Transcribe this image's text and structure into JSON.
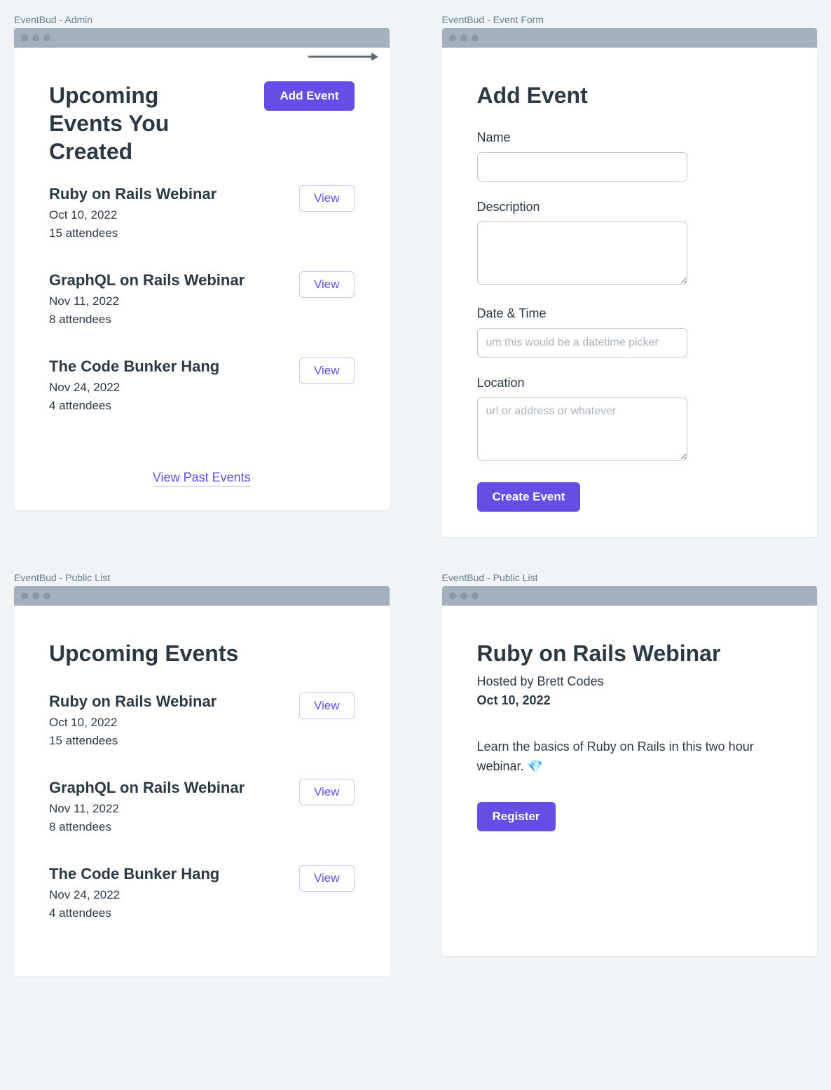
{
  "admin": {
    "window_label": "EventBud - Admin",
    "title": "Upcoming Events You Created",
    "add_button": "Add Event",
    "events": [
      {
        "title": "Ruby on Rails Webinar",
        "date": "Oct 10, 2022",
        "attendees": "15 attendees",
        "view": "View"
      },
      {
        "title": "GraphQL on Rails Webinar",
        "date": "Nov 11, 2022",
        "attendees": "8 attendees",
        "view": "View"
      },
      {
        "title": "The Code Bunker Hang",
        "date": "Nov 24, 2022",
        "attendees": "4 attendees",
        "view": "View"
      }
    ],
    "past_link": "View Past Events"
  },
  "form": {
    "window_label": "EventBud - Event Form",
    "title": "Add Event",
    "fields": {
      "name_label": "Name",
      "description_label": "Description",
      "datetime_label": "Date & Time",
      "datetime_placeholder": "um this would be a datetime picker",
      "location_label": "Location",
      "location_placeholder": "url or address or whatever"
    },
    "submit": "Create Event"
  },
  "public": {
    "window_label": "EventBud - Public List",
    "title": "Upcoming Events",
    "events": [
      {
        "title": "Ruby on Rails Webinar",
        "date": "Oct 10, 2022",
        "attendees": "15 attendees",
        "view": "View"
      },
      {
        "title": "GraphQL on Rails Webinar",
        "date": "Nov 11, 2022",
        "attendees": "8 attendees",
        "view": "View"
      },
      {
        "title": "The Code Bunker Hang",
        "date": "Nov 24, 2022",
        "attendees": "4 attendees",
        "view": "View"
      }
    ]
  },
  "detail": {
    "window_label": "EventBud - Public List",
    "title": "Ruby on Rails Webinar",
    "host": "Hosted by Brett Codes",
    "date": "Oct 10, 2022",
    "description": "Learn the basics of Ruby on Rails in this two hour webinar. 💎",
    "register": "Register"
  }
}
